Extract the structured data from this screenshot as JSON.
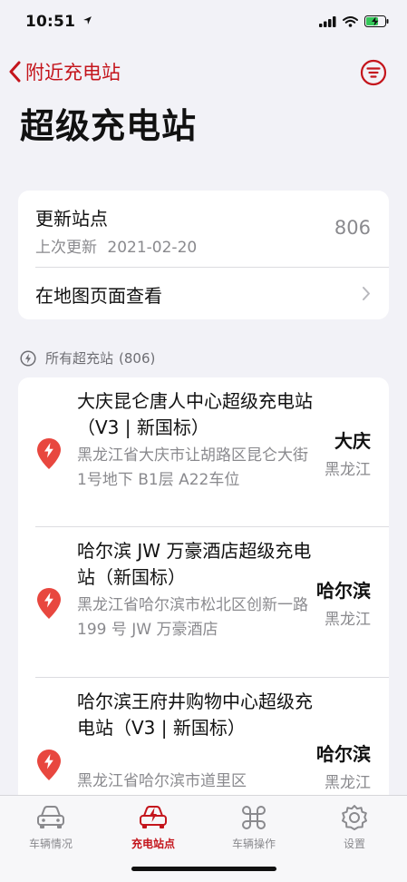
{
  "status_bar": {
    "time": "10:51"
  },
  "nav": {
    "back_label": "附近充电站",
    "title": "超级充电站"
  },
  "update_card": {
    "title": "更新站点",
    "last_update_label": "上次更新",
    "last_update_date": "2021-02-20",
    "count": "806",
    "map_label": "在地图页面查看"
  },
  "section": {
    "header": "所有超充站",
    "count": "(806)"
  },
  "stations": [
    {
      "name": "大庆昆仑唐人中心超级充电站（V3 | 新国标）",
      "address": "黑龙江省大庆市让胡路区昆仑大街1号地下 B1层 A22车位",
      "city": "大庆",
      "province": "黑龙江"
    },
    {
      "name": "哈尔滨 JW 万豪酒店超级充电站（新国标）",
      "address": "黑龙江省哈尔滨市松北区创新一路 199 号 JW 万豪酒店",
      "city": "哈尔滨",
      "province": "黑龙江"
    },
    {
      "name": "哈尔滨王府井购物中心超级充电站（V3 | 新国标）",
      "address": "黑龙江省哈尔滨市道里区",
      "city": "哈尔滨",
      "province": "黑龙江"
    }
  ],
  "tabs": [
    {
      "label": "车辆情况",
      "icon": "car-icon",
      "active": false
    },
    {
      "label": "充电站点",
      "icon": "charging-car-icon",
      "active": true
    },
    {
      "label": "车辆操作",
      "icon": "command-icon",
      "active": false
    },
    {
      "label": "设置",
      "icon": "gear-icon",
      "active": false
    }
  ],
  "colors": {
    "accent": "#c4151c",
    "pin": "#e8473f",
    "background": "#f2f2f7",
    "secondary_text": "#8a8a8e"
  }
}
